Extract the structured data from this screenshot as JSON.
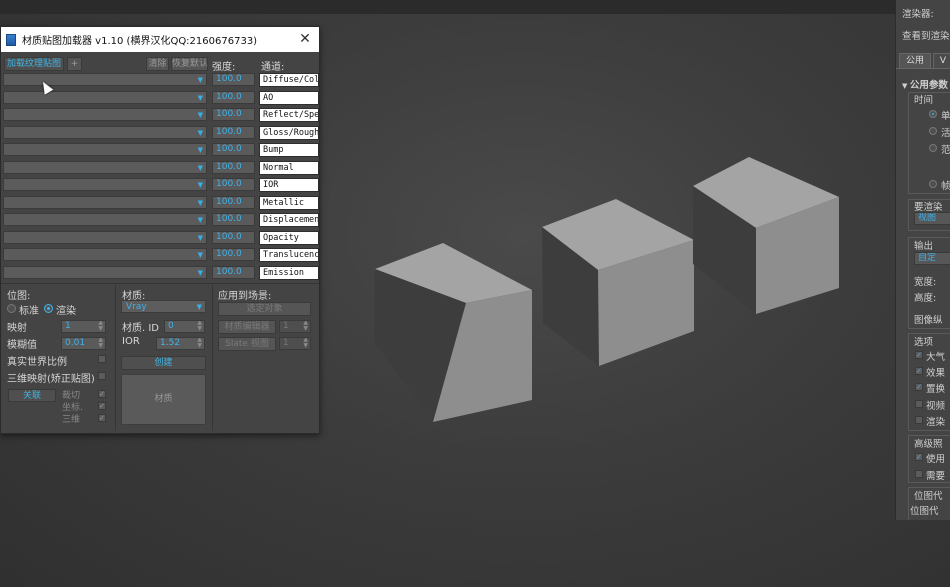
{
  "dialog": {
    "title": "材质贴图加载器 v1.10 (横界汉化QQ:2160676733)",
    "close_label": "✕",
    "toolbar": {
      "load_label": "加载纹理贴图",
      "add_label": "+",
      "clear_label": "清除",
      "reset_label": "恢复默认",
      "strength_header": "强度:",
      "channel_header": "通道:"
    },
    "channels": [
      {
        "strength": "100.0",
        "name": "Diffuse/Col"
      },
      {
        "strength": "100.0",
        "name": "AO"
      },
      {
        "strength": "100.0",
        "name": "Reflect/Spe"
      },
      {
        "strength": "100.0",
        "name": "Gloss/Rough"
      },
      {
        "strength": "100.0",
        "name": "Bump"
      },
      {
        "strength": "100.0",
        "name": "Normal"
      },
      {
        "strength": "100.0",
        "name": "IOR"
      },
      {
        "strength": "100.0",
        "name": "Metallic"
      },
      {
        "strength": "100.0",
        "name": "Displacemen"
      },
      {
        "strength": "100.0",
        "name": "Opacity"
      },
      {
        "strength": "100.0",
        "name": "Translucenc"
      },
      {
        "strength": "100.0",
        "name": "Emission"
      }
    ],
    "bitmap": {
      "header": "位图:",
      "radio_standard": "标准",
      "radio_render": "渲染",
      "mapping_label": "映射",
      "mapping_value": "1",
      "blur_label": "模糊值",
      "blur_value": "0.01",
      "realworld_label": "真实世界比例",
      "triplanar_label": "三维映射(矫正贴图)",
      "close_label": "关联",
      "crop_label": "裁切",
      "coord_label": "坐标.",
      "tri_label": "三维"
    },
    "material": {
      "header": "材质:",
      "type_value": "Vray",
      "matid_label": "材质. ID",
      "matid_value": "0",
      "ior_label": "IOR",
      "ior_value": "1.52",
      "create_label": "创建",
      "preview_label": "材质"
    },
    "apply": {
      "header": "应用到场景:",
      "selected_label": "选定对象",
      "editor_label": "材质编辑器",
      "editor_value": "1",
      "slate_label": "Slate 视图",
      "slate_value": "1"
    }
  },
  "right_panel": {
    "renderer_label": "渲染器:",
    "view_label": "查看到渲染",
    "tab_common": "公用",
    "tab_v": "V",
    "rollout_common": "公用参数",
    "time_label": "时间",
    "opt_single": "单",
    "opt_active": "活",
    "opt_range": "范",
    "opt_frames": "帧",
    "area_label": "要渲染",
    "area_value": "视图",
    "output_label": "输出",
    "output_value": "自定",
    "width_label": "宽度:",
    "height_label": "高度:",
    "aspect_label": "图像纵",
    "options_label": "选项",
    "opt_atmos": "大气",
    "opt_effects": "效果",
    "opt_displace": "置换",
    "opt_video": "视频",
    "opt_render": "渲染",
    "advanced_label": "高级照",
    "opt_use": "使用",
    "opt_need": "需要",
    "bitmap_label": "位图代",
    "bitmap_label2": "位图代"
  }
}
